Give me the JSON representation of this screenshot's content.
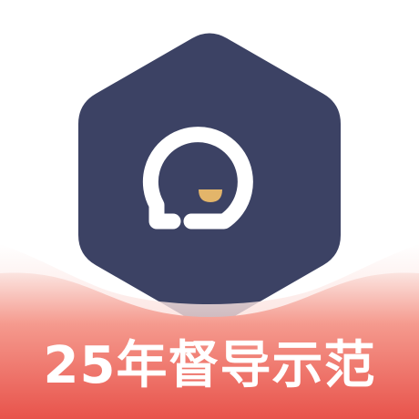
{
  "banner": {
    "text": "25年督导示范"
  },
  "logo": {
    "icon": "chat-bubble-smile-icon",
    "hexagon_color": "#3c4264",
    "bubble_color": "#ffffff",
    "smile_color": "#e3b56a"
  },
  "ribbon": {
    "top_color": "#fbe4e0",
    "mid_color": "#f59a8e",
    "bottom_color": "#e8534b"
  }
}
